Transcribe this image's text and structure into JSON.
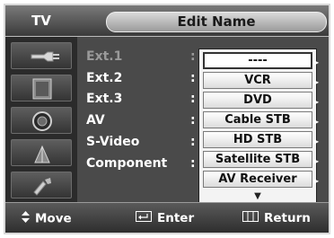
{
  "header": {
    "tv_label": "TV",
    "title": "Edit Name"
  },
  "sources": [
    {
      "label": "Ext.1",
      "dim": true
    },
    {
      "label": "Ext.2",
      "dim": false
    },
    {
      "label": "Ext.3",
      "dim": false
    },
    {
      "label": "AV",
      "dim": false
    },
    {
      "label": "S-Video",
      "dim": false
    },
    {
      "label": "Component",
      "dim": false
    }
  ],
  "colon": ":",
  "dropdown": {
    "options": [
      "----",
      "VCR",
      "DVD",
      "Cable STB",
      "HD STB",
      "Satellite STB",
      "AV Receiver"
    ],
    "selected_index": 0,
    "more_icon": "▼"
  },
  "footer": {
    "move_label": "Move",
    "enter_label": "Enter",
    "return_label": "Return"
  },
  "icons": {
    "sidebar": [
      "input-icon",
      "picture-icon",
      "sound-icon",
      "channel-icon",
      "setup-icon"
    ],
    "move": "up-down-arrows-icon",
    "enter": "enter-icon",
    "return": "return-icon"
  },
  "colors": {
    "accent": "#f3f3f3",
    "panel": "#4a4a4a",
    "text": "#ffffff"
  }
}
